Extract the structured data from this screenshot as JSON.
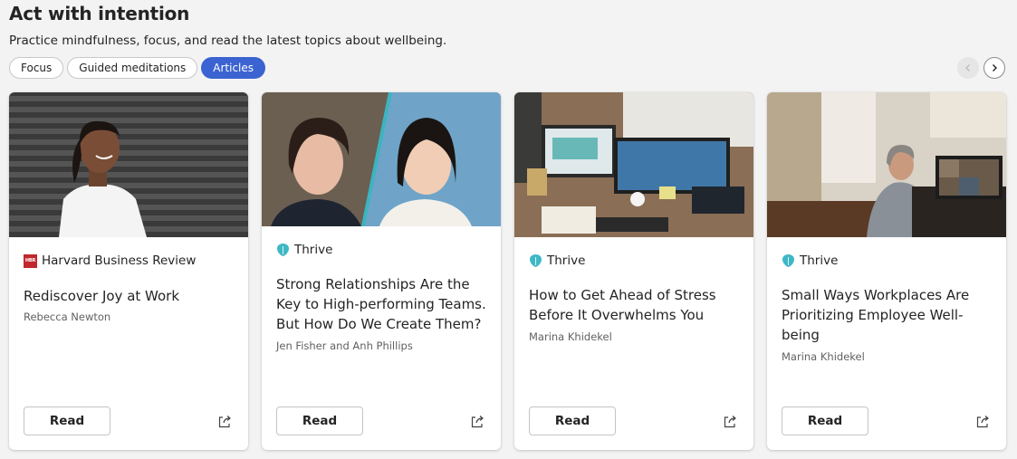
{
  "header": {
    "title": "Act with intention",
    "subtitle": "Practice mindfulness, focus, and read the latest topics about wellbeing."
  },
  "tabs": [
    {
      "label": "Focus",
      "active": false
    },
    {
      "label": "Guided meditations",
      "active": false
    },
    {
      "label": "Articles",
      "active": true
    }
  ],
  "nav": {
    "prev_icon": "chevron-left-icon",
    "next_icon": "chevron-right-icon"
  },
  "cards": [
    {
      "source": "Harvard Business Review",
      "source_icon": "hbr-logo",
      "source_logo_text": "HBR",
      "title": "Rediscover Joy at Work",
      "author": "Rebecca Newton",
      "image": "woman-smiling-brick-wall",
      "button": "Read"
    },
    {
      "source": "Thrive",
      "source_icon": "thrive-logo",
      "title": "Strong Relationships Are the Key to High-performing Teams. But How Do We Create Them?",
      "author": "Jen Fisher and Anh Phillips",
      "image": "two-women-portraits",
      "button": "Read"
    },
    {
      "source": "Thrive",
      "source_icon": "thrive-logo",
      "title": "How to Get Ahead of Stress Before It Overwhelms You",
      "author": "Marina Khidekel",
      "image": "desk-with-monitors",
      "button": "Read"
    },
    {
      "source": "Thrive",
      "source_icon": "thrive-logo",
      "title": "Small Ways Workplaces Are Prioritizing Employee Well-being",
      "author": "Marina Khidekel",
      "image": "man-video-call-kitchen",
      "button": "Read"
    }
  ],
  "colors": {
    "accent": "#3b63d1",
    "background": "#f3f3f3",
    "hbr_red": "#c1272d",
    "thrive_teal": "#3fb8c6"
  }
}
